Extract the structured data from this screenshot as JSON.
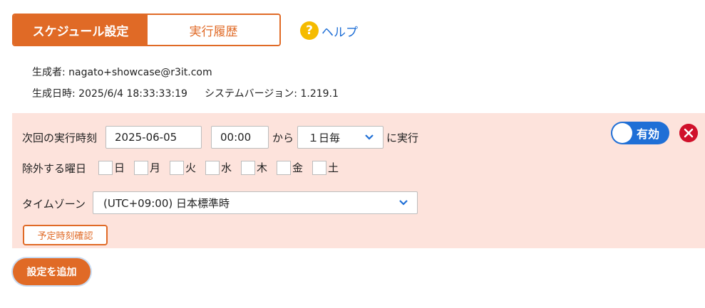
{
  "tabs": [
    {
      "label": "スケジュール設定",
      "active": true
    },
    {
      "label": "実行履歴",
      "active": false
    }
  ],
  "help": {
    "icon": "question-circle-icon",
    "label": "ヘルプ"
  },
  "meta": {
    "creator": "生成者: nagato+showcase@r3it.com",
    "created_at": "生成日時: 2025/6/4 18:33:33:19",
    "system_version": "システムバージョン: 1.219.1"
  },
  "schedule": {
    "next_run_label": "次回の実行時刻",
    "date_value": "2025-06-05",
    "time_value": "00:00",
    "from_label": "から",
    "interval_value": "１日毎",
    "run_label": "に実行",
    "exclude_label": "除外する曜日",
    "weekdays": [
      "日",
      "月",
      "火",
      "水",
      "木",
      "金",
      "土"
    ],
    "timezone_label": "タイムゾーン",
    "timezone_value": "(UTC+09:00) 日本標準時",
    "check_button": "予定時刻確認",
    "toggle_label": "有効",
    "toggle_on": true
  },
  "add_button": "設定を追加",
  "colors": {
    "accent": "#e06a26",
    "panel_bg": "#fde3dc",
    "link": "#1f6fd6",
    "danger": "#d0112b",
    "help": "#f5bb00"
  }
}
